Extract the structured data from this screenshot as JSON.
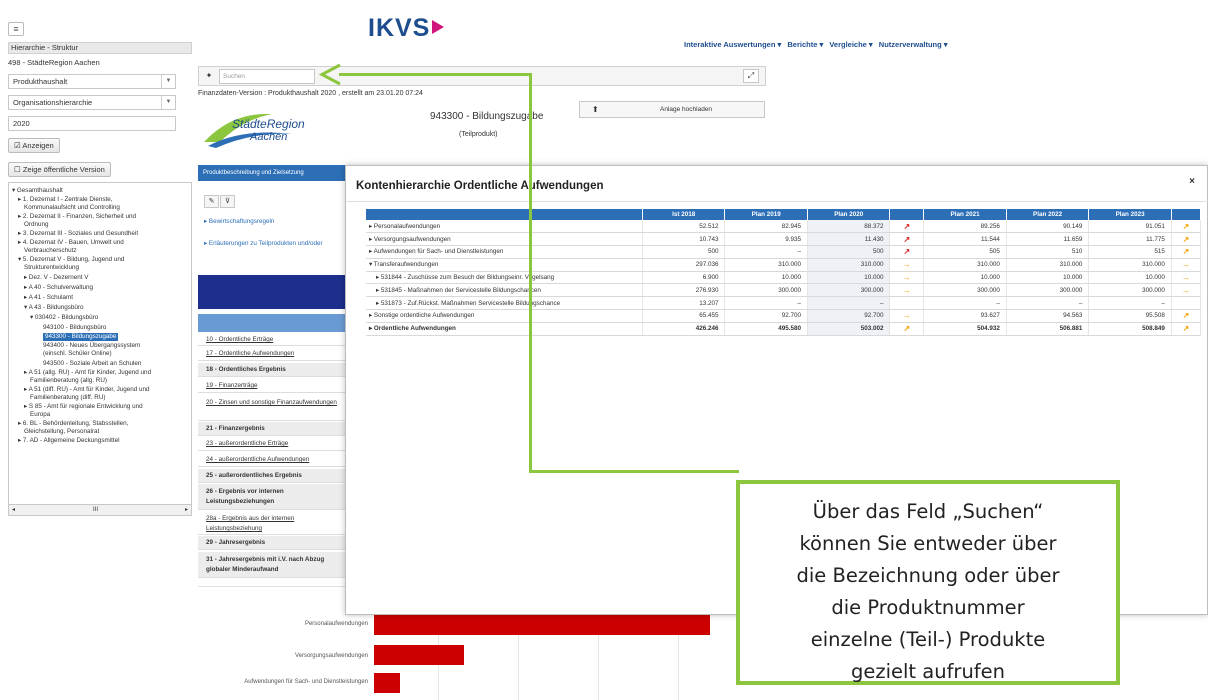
{
  "left": {
    "menu_icon": "hamburger-icon",
    "header": "Hierarchie - Struktur",
    "region": "498 - StädteRegion Aachen",
    "select_haushalt": "Produkthaushalt",
    "select_hierarchie": "Organisationshierarchie",
    "year": "2020",
    "show_button": "Anzeigen",
    "public_button": "Zeige öffentliche Version",
    "tree": [
      "▾ Gesamthaushalt",
      "▸ 1. Dezernat I - Zentrale Dienste,",
      "Kommunalaufsicht und Controlling",
      "▸ 2. Dezernat II - Finanzen, Sicherheit und",
      "Ordnung",
      "▸ 3. Dezernat III - Soziales und Gesundheit",
      "▸ 4. Dezernat IV - Bauen, Umwelt und",
      "Verbraucherschutz",
      "▾ 5. Dezernat V - Bildung, Jugend und",
      "Strukturentwicklung",
      "▸ Dez. V - Dezernent V",
      "▸ A 40 - Schulverwaltung",
      "▸ A 41 - Schulamt",
      "▾ A 43 - Bildungsbüro",
      "▾ 030402 - Bildungsbüro",
      "943100 - Bildungsbüro",
      "943300 - Bildungszugabe",
      "943400 - Neues Übergangssystem",
      "(einschl. Schüler Online)",
      "943500 - Soziale Arbeit an Schulen",
      "▸ A 51 (allg. RU) - Amt für Kinder, Jugend und",
      "Familienberatung (allg. RU)",
      "▸ A 51 (diff. RU) - Amt für Kinder, Jugend und",
      "Familienberatung (diff. RU)",
      "▸ S 85 - Amt für regionale Entwicklung und",
      "Europa",
      "▸ 6. BL - Behördenleitung, Stabsstellen,",
      "Gleichstellung, Personalrat",
      "▸ 7. AD - Allgemeine Deckungsmittel"
    ],
    "scroll_label": "III"
  },
  "header": {
    "logo": "IKVS",
    "nav": [
      "Interaktive Auswertungen ▾",
      "Berichte ▾",
      "Vergleiche ▾",
      "Nutzerverwaltung ▾"
    ]
  },
  "main": {
    "search_placeholder": "Suchen",
    "version": "Finanzdaten-Version : Produkthaushalt 2020 , erstellt am 23.01.20 07:24",
    "city_logo_line1": "StädteRegion",
    "city_logo_line2": "Aachen",
    "product_title": "943300 - Bildungszugabe",
    "product_sub": "(Teilprodukt)",
    "upload_label": "Anlage hochladen",
    "tab_label": "Produktbeschreibung und Zielsetzung",
    "link1": "Bewirtschaftungsregeln",
    "link2": "Erläuterungen zu Teilprodukten und/oder",
    "flow_rows": [
      {
        "label": "10 - Ordentliche Erträge",
        "style": "u"
      },
      {
        "label": "17 - Ordentliche Aufwendungen",
        "style": "u"
      },
      {
        "label": "18 - Ordentliches Ergebnis",
        "style": "b"
      },
      {
        "label": "19 - Finanzerträge",
        "style": "u"
      },
      {
        "label": "20 - Zinsen und sonstige Finanzaufwendungen",
        "style": "u"
      },
      {
        "label": "21 - Finanzergebnis",
        "style": "b"
      },
      {
        "label": "23 - außerordentliche Erträge",
        "style": "u"
      },
      {
        "label": "24 - außerordentliche Aufwendungen",
        "style": "u"
      },
      {
        "label": "25 - außerordentliches Ergebnis",
        "style": "b"
      },
      {
        "label": "26 - Ergebnis vor internen Leistungsbeziehungen",
        "style": "b"
      },
      {
        "label": "28a - Ergebnis aus der internen Leistungsbeziehung",
        "style": "u"
      },
      {
        "label": "29 - Jahresergebnis",
        "style": "b"
      },
      {
        "label": "31 - Jahresergebnis mit i.V. nach Abzug globaler Minderaufwand",
        "style": "b"
      }
    ],
    "chart_labels": [
      "Personalaufwendungen",
      "Versorgungsaufwendungen",
      "Aufwendungen für Sach- und Dienstleistungen"
    ]
  },
  "modal": {
    "title": "Kontenhierarchie Ordentliche Aufwendungen",
    "close": "×",
    "columns": [
      "",
      "Ist 2018",
      "Plan 2019",
      "Plan 2020",
      "",
      "Plan 2021",
      "Plan 2022",
      "Plan 2023",
      ""
    ],
    "rows": [
      {
        "name": "▸ Personalaufwendungen",
        "vals": [
          "52.512",
          "82.945",
          "88.372"
        ],
        "a1": "↗",
        "a1c": "up",
        "vals2": [
          "89.256",
          "90.149",
          "91.051"
        ],
        "a2": "↗",
        "a2c": "upo",
        "ind": false,
        "total": false
      },
      {
        "name": "▸ Versorgungsaufwendungen",
        "vals": [
          "10.743",
          "9.935",
          "11.430"
        ],
        "a1": "↗",
        "a1c": "up",
        "vals2": [
          "11.544",
          "11.659",
          "11.775"
        ],
        "a2": "↗",
        "a2c": "upo",
        "ind": false,
        "total": false
      },
      {
        "name": "▸ Aufwendungen für Sach- und Dienstleistungen",
        "vals": [
          "500",
          "–",
          "500"
        ],
        "a1": "↗",
        "a1c": "up",
        "vals2": [
          "505",
          "510",
          "515"
        ],
        "a2": "↗",
        "a2c": "upo",
        "ind": false,
        "total": false
      },
      {
        "name": "▾ Transferaufwendungen",
        "vals": [
          "297.036",
          "310.000",
          "310.000"
        ],
        "a1": "→",
        "a1c": "right",
        "vals2": [
          "310.000",
          "310.000",
          "310.000"
        ],
        "a2": "→",
        "a2c": "right",
        "ind": false,
        "total": false
      },
      {
        "name": "▸ 531844 - Zuschüsse zum Besuch der Bildungseinr. Vogelsang",
        "vals": [
          "6.900",
          "10.000",
          "10.000"
        ],
        "a1": "→",
        "a1c": "right",
        "vals2": [
          "10.000",
          "10.000",
          "10.000"
        ],
        "a2": "→",
        "a2c": "right",
        "ind": true,
        "total": false
      },
      {
        "name": "▸ 531845 - Maßnahmen der Servicestelle Bildungschancen",
        "vals": [
          "276.930",
          "300.000",
          "300.000"
        ],
        "a1": "→",
        "a1c": "right",
        "vals2": [
          "300.000",
          "300.000",
          "300.000"
        ],
        "a2": "→",
        "a2c": "right",
        "ind": true,
        "total": false
      },
      {
        "name": "▸ 531873 - Zuf.Rückst. Maßnahmen Servicestelle Bildungschance",
        "vals": [
          "13.207",
          "–",
          "–"
        ],
        "a1": "",
        "a1c": "",
        "vals2": [
          "–",
          "–",
          "–"
        ],
        "a2": "",
        "a2c": "",
        "ind": true,
        "total": false
      },
      {
        "name": "▸ Sonstige ordentliche Aufwendungen",
        "vals": [
          "65.455",
          "92.700",
          "92.700"
        ],
        "a1": "→",
        "a1c": "right",
        "vals2": [
          "93.627",
          "94.563",
          "95.508"
        ],
        "a2": "↗",
        "a2c": "upo",
        "ind": false,
        "total": false
      },
      {
        "name": "▸ Ordentliche Aufwendungen",
        "vals": [
          "426.246",
          "495.580",
          "503.002"
        ],
        "a1": "↗",
        "a1c": "upo",
        "vals2": [
          "504.932",
          "506.881",
          "508.849"
        ],
        "a2": "↗",
        "a2c": "upo",
        "ind": false,
        "total": true
      }
    ]
  },
  "callout": {
    "lines": [
      "Über das Feld „Suchen“",
      "können Sie entweder über",
      "die Bezeichnung oder über",
      "die Produktnummer",
      "einzelne (Teil-) Produkte",
      "gezielt aufrufen"
    ],
    "border_color": "#8cc63e"
  }
}
